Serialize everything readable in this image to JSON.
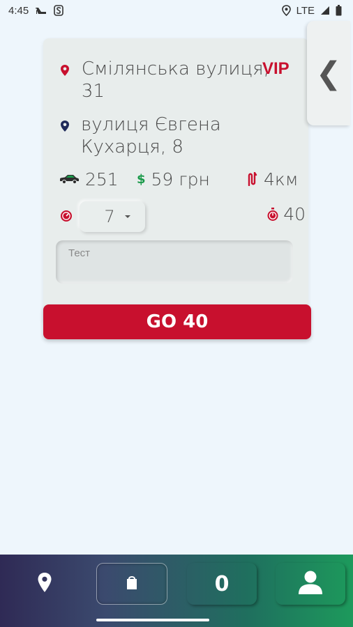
{
  "status_bar": {
    "time": "4:45",
    "network": "LTE",
    "icons": [
      "heels-icon",
      "s-icon",
      "location-icon",
      "signal-icon",
      "battery-icon"
    ]
  },
  "order": {
    "pickup_address": "Смілянська вулиця, 31",
    "vip_label": "VIP",
    "dropoff_address": "вулиця Євгена Кухарця, 8",
    "car_distance": "251",
    "price": "59 грн",
    "route_distance": "4км",
    "selected_minutes": "7",
    "timer_value": "40",
    "comment_placeholder": "Тест",
    "go_button_label": "GO 40"
  },
  "side_tab": {
    "label": "❮"
  },
  "bottom_nav": {
    "count": "0",
    "items": [
      "location-icon",
      "store-icon",
      "count",
      "user-icon"
    ]
  },
  "colors": {
    "accent": "#c8102e",
    "card_bg": "#e8edec",
    "page_bg": "#eef6fc",
    "price_green": "#1a9a4a",
    "dropoff_pin": "#1f2a5a"
  }
}
